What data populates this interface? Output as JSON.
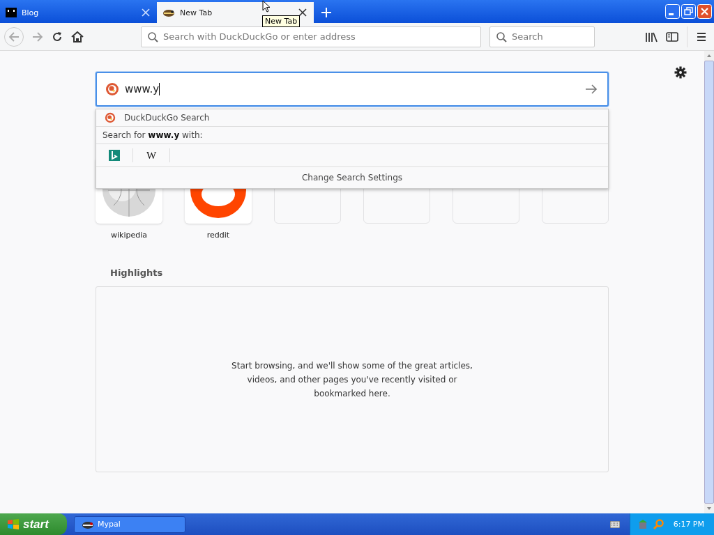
{
  "tabs": [
    {
      "title": "Blog",
      "selected": false,
      "kind": "blog"
    },
    {
      "title": "New Tab",
      "selected": true,
      "kind": "newtab"
    }
  ],
  "tooltip": "New Tab",
  "navigation": {
    "back_disabled": true,
    "forward_disabled": true
  },
  "toolbar": {
    "address_placeholder": "Search with DuckDuckGo or enter address",
    "search_placeholder": "Search"
  },
  "search_box": {
    "value": "www.y"
  },
  "suggestions": {
    "engine_row": "DuckDuckGo Search",
    "search_for": "Search for **www.y** with:",
    "engines": [
      {
        "kind": "bing"
      },
      {
        "kind": "wikipedia",
        "glyph": "W"
      }
    ],
    "settings": "Change Search Settings"
  },
  "top_sites": [
    {
      "kind": "wikipedia",
      "label": "wikipedia"
    },
    {
      "kind": "reddit",
      "label": "reddit"
    },
    {
      "kind": "empty"
    },
    {
      "kind": "empty"
    },
    {
      "kind": "empty"
    },
    {
      "kind": "empty"
    }
  ],
  "highlights": {
    "title": "Highlights",
    "message": "Start browsing, and we'll show some of the great articles, videos, and other pages you've recently visited or bookmarked here."
  },
  "taskbar": {
    "start": "start",
    "windows": [
      {
        "title": "Mypal"
      }
    ],
    "clock": "6:17 PM"
  }
}
